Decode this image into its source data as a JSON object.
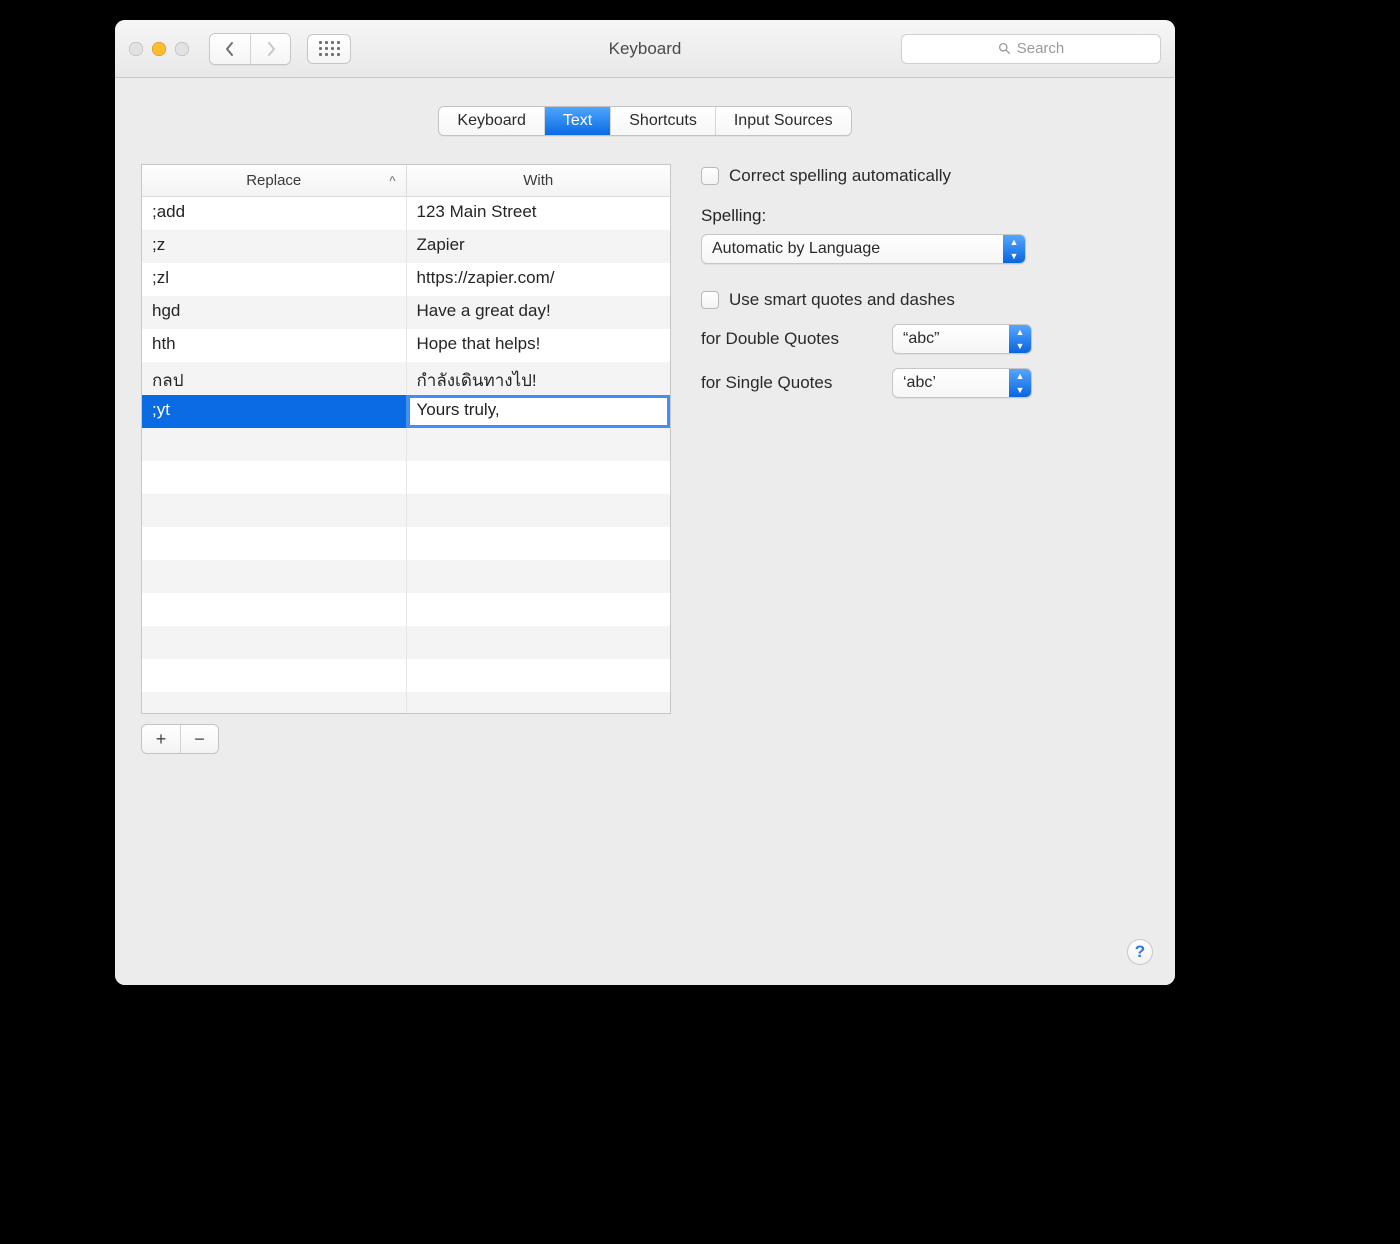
{
  "window": {
    "title": "Keyboard"
  },
  "search": {
    "placeholder": "Search"
  },
  "tabs": {
    "items": [
      "Keyboard",
      "Text",
      "Shortcuts",
      "Input Sources"
    ],
    "active_index": 1
  },
  "table": {
    "headers": {
      "replace": "Replace",
      "with": "With"
    },
    "sort_indicator": "^",
    "rows": [
      {
        "replace": ";add",
        "with": "123 Main Street"
      },
      {
        "replace": ";z",
        "with": "Zapier"
      },
      {
        "replace": ";zl",
        "with": "https://zapier.com/"
      },
      {
        "replace": "hgd",
        "with": "Have a great day!"
      },
      {
        "replace": "hth",
        "with": "Hope that helps!"
      },
      {
        "replace": "กลป",
        "with": "กำลังเดินทางไป!"
      },
      {
        "replace": ";yt",
        "with": "Yours truly,"
      }
    ],
    "selected_index": 6,
    "editing_with_index": 6,
    "visible_row_count": 16
  },
  "buttons": {
    "add": "+",
    "remove": "−"
  },
  "options": {
    "correct_spelling": {
      "label": "Correct spelling automatically",
      "checked": false
    },
    "spelling_label": "Spelling:",
    "spelling_value": "Automatic by Language",
    "smart_quotes": {
      "label": "Use smart quotes and dashes",
      "checked": false
    },
    "double_quotes": {
      "label": "for Double Quotes",
      "value": "“abc”"
    },
    "single_quotes": {
      "label": "for Single Quotes",
      "value": "‘abc’"
    }
  },
  "help": "?"
}
